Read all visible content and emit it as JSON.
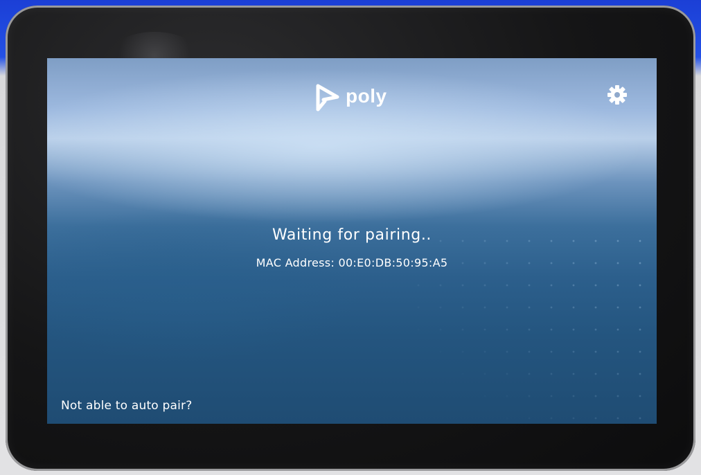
{
  "brand": {
    "logo_text": "poly",
    "logo_icon": "poly-logo-icon"
  },
  "toolbar": {
    "settings_icon": "gear-icon"
  },
  "pairing": {
    "status": "Waiting for pairing..",
    "mac_address": "MAC Address: 00:E0:DB:50:95:A5"
  },
  "footer": {
    "help_link": "Not able to auto pair?"
  },
  "colors": {
    "text": "#ffffff",
    "screen_top": "#9db9df",
    "screen_bottom": "#1f4c73",
    "bezel": "#151516"
  }
}
